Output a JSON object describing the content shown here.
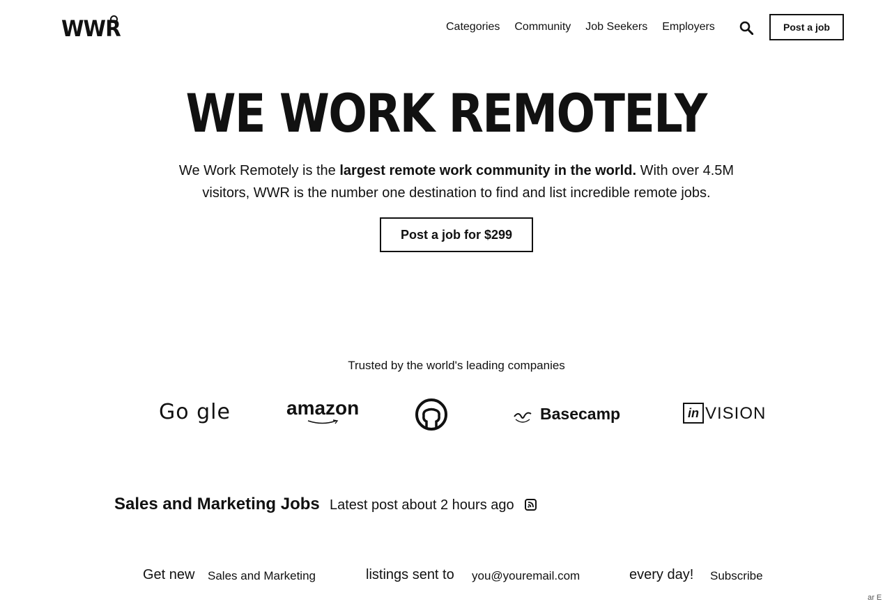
{
  "header": {
    "logo_text": "WWR",
    "nav": [
      "Categories",
      "Community",
      "Job Seekers",
      "Employers"
    ],
    "post_button": "Post a job"
  },
  "hero": {
    "title": "WE WORK REMOTELY",
    "desc_pre": "We Work Remotely is the ",
    "desc_bold": "largest remote work community in the world.",
    "desc_post": " With over 4.5M visitors, WWR is the number one destination to find and list incredible remote jobs.",
    "cta": "Post a job for $299"
  },
  "trusted": {
    "heading": "Trusted by the world's leading companies",
    "logos": {
      "google": "Go gle",
      "amazon": "amazon",
      "basecamp": "Basecamp",
      "invision_box": "in",
      "invision": "VISION"
    }
  },
  "section": {
    "title": "Sales and Marketing Jobs",
    "meta": "Latest post about 2 hours ago"
  },
  "subscribe": {
    "prefix": "Get new",
    "category_value": "Sales and Marketing",
    "middle": "listings sent to",
    "email_placeholder": "you@youremail.com",
    "suffix": "every day!",
    "button": "Subscribe"
  },
  "corner_text": "ar E"
}
